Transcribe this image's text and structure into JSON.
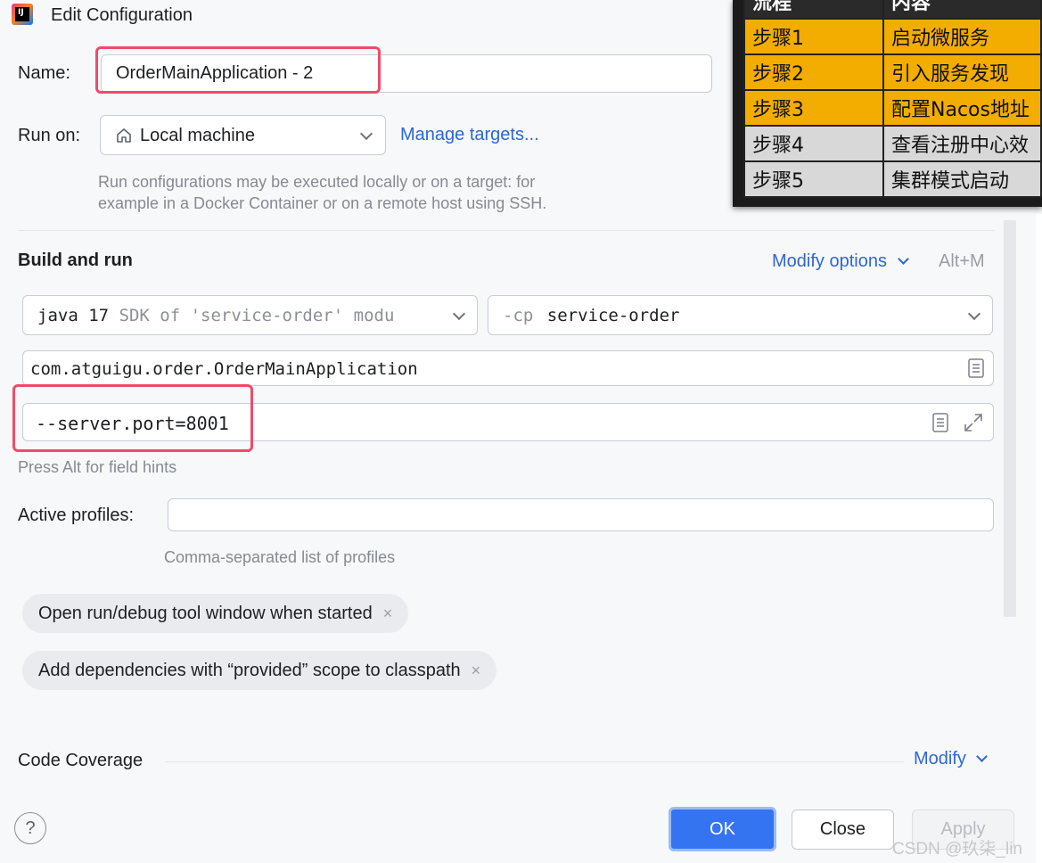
{
  "window": {
    "title": "Edit Configuration"
  },
  "name_field": {
    "label": "Name:",
    "value": "OrderMainApplication - 2"
  },
  "run_on": {
    "label": "Run on:",
    "value": "Local machine",
    "manage_link": "Manage targets...",
    "hint_line1": "Run configurations may be executed locally or on a target: for",
    "hint_line2": "example in a Docker Container or on a remote host using SSH."
  },
  "build_and_run": {
    "heading": "Build and run",
    "modify_options": "Modify options",
    "shortcut": "Alt+M",
    "jdk_version": "java 17",
    "jdk_detail": "SDK of 'service-order' modu",
    "classpath_flag": "-cp",
    "classpath_value": "service-order",
    "main_class": "com.atguigu.order.OrderMainApplication",
    "program_args": "--server.port=8001",
    "field_hint": "Press Alt for field hints"
  },
  "active_profiles": {
    "label": "Active profiles:",
    "value": "",
    "hint": "Comma-separated list of profiles"
  },
  "options": [
    {
      "label": "Open run/debug tool window when started",
      "remove": "×"
    },
    {
      "label": "Add dependencies with “provided” scope to classpath",
      "remove": "×"
    }
  ],
  "code_coverage": {
    "heading": "Code Coverage",
    "modify": "Modify"
  },
  "buttons": {
    "help": "?",
    "ok": "OK",
    "close": "Close",
    "apply": "Apply"
  },
  "watermark": "CSDN @玖柒_lin",
  "overlay_table": {
    "headers": [
      "流程",
      "内容"
    ],
    "rows": [
      {
        "step": "步骤1",
        "content": "启动微服务"
      },
      {
        "step": "步骤2",
        "content": "引入服务发现"
      },
      {
        "step": "步骤3",
        "content": "配置Nacos地址"
      },
      {
        "step": "步骤4",
        "content": "查看注册中心效"
      },
      {
        "step": "步骤5",
        "content": "集群模式启动"
      }
    ]
  },
  "colors": {
    "accent": "#2e66d6",
    "highlight_border": "#ef4b6b",
    "table_orange": "#f2ad00",
    "table_gray": "#d8d8d8"
  }
}
